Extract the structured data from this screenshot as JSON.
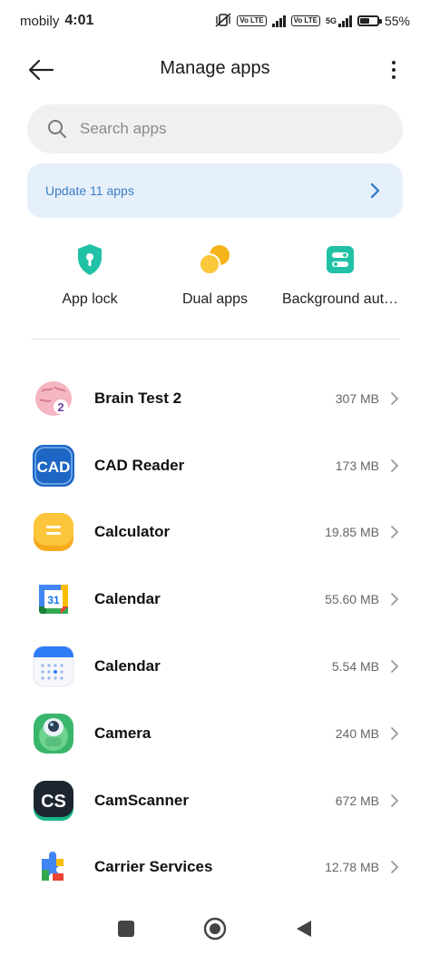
{
  "status": {
    "carrier": "mobily",
    "time": "4:01",
    "network": "5G",
    "volte1": "Vo LTE",
    "volte2": "Vo LTE",
    "battery_text": "55%",
    "battery_level": 0.55
  },
  "header": {
    "title": "Manage apps"
  },
  "search": {
    "placeholder": "Search apps"
  },
  "update_banner": {
    "label": "Update 11 apps"
  },
  "tools": [
    {
      "label": "App lock",
      "icon": "shield-lock-icon",
      "color": "#21c1a6"
    },
    {
      "label": "Dual apps",
      "icon": "dual-apps-icon",
      "color": "#f6b41a"
    },
    {
      "label": "Background aut…",
      "icon": "background-autostart-icon",
      "color": "#21c1a6"
    }
  ],
  "apps": [
    {
      "name": "Brain Test 2",
      "size": "307 MB",
      "icon": "brain-test-icon"
    },
    {
      "name": "CAD Reader",
      "size": "173 MB",
      "icon": "cad-reader-icon"
    },
    {
      "name": "Calculator",
      "size": "19.85 MB",
      "icon": "calculator-icon"
    },
    {
      "name": "Calendar",
      "size": "55.60 MB",
      "icon": "google-calendar-icon"
    },
    {
      "name": "Calendar",
      "size": "5.54 MB",
      "icon": "calendar-icon"
    },
    {
      "name": "Camera",
      "size": "240 MB",
      "icon": "camera-icon"
    },
    {
      "name": "CamScanner",
      "size": "672 MB",
      "icon": "camscanner-icon"
    },
    {
      "name": "Carrier Services",
      "size": "12.78 MB",
      "icon": "carrier-services-icon"
    }
  ],
  "icon_text": {
    "cad": "CAD",
    "gcal_day": "31",
    "camscanner": "CS",
    "brain": "2"
  },
  "colors": {
    "accent_blue": "#3a7fc6",
    "banner_bg": "#e6f0fb",
    "teal": "#21c1a6",
    "yellow": "#f6b41a"
  }
}
